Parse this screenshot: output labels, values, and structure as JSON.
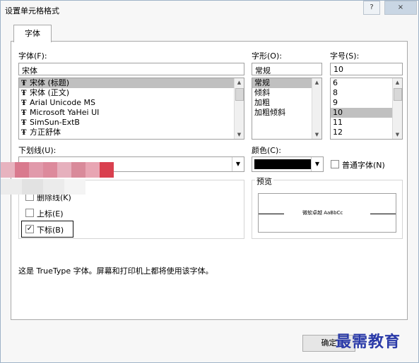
{
  "dialog": {
    "title": "设置单元格格式",
    "help_button": "?",
    "close_button": "×"
  },
  "tabs": [
    {
      "label": "字体"
    }
  ],
  "font": {
    "label": "字体(F):",
    "value": "宋体",
    "items": [
      "宋体 (标题)",
      "宋体 (正文)",
      "Arial Unicode MS",
      "Microsoft YaHei UI",
      "SimSun-ExtB",
      "方正舒体"
    ],
    "selected_index": 0
  },
  "style": {
    "label": "字形(O):",
    "value": "常规",
    "items": [
      "常规",
      "倾斜",
      "加粗",
      "加粗倾斜"
    ],
    "selected_index": 0
  },
  "size": {
    "label": "字号(S):",
    "value": "10",
    "items": [
      "6",
      "8",
      "9",
      "10",
      "11",
      "12"
    ],
    "selected_index": 3
  },
  "underline": {
    "label": "下划线(U):",
    "value": ""
  },
  "color": {
    "label": "颜色(C):",
    "value": "#000000"
  },
  "normal_font": {
    "label": "普通字体(N)",
    "checked": false
  },
  "effects": {
    "strikethrough": {
      "label": "删除线(K)",
      "checked": false
    },
    "superscript": {
      "label": "上标(E)",
      "checked": false
    },
    "subscript": {
      "label": "下标(B)",
      "checked": true,
      "check_glyph": "✓"
    }
  },
  "preview": {
    "label": "预览",
    "sample": "微软卓越  AaBbCc"
  },
  "info_text": "这是 TrueType 字体。屏幕和打印机上都将使用该字体。",
  "ok_button": "确定",
  "watermark": "最需教育",
  "icons": {
    "truetype": "Ŧ",
    "scroll_up": "▲",
    "scroll_down": "▼",
    "dropdown": "▼"
  }
}
